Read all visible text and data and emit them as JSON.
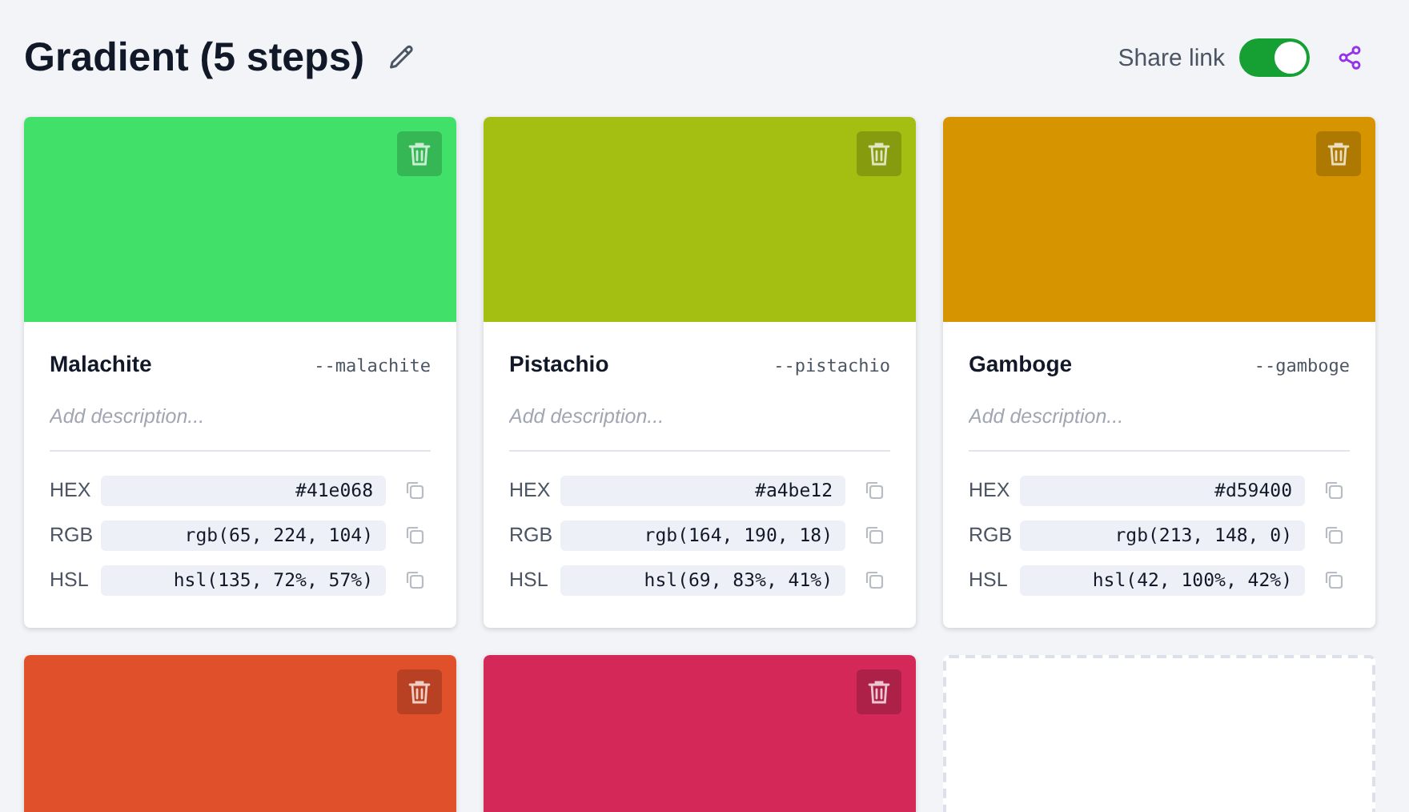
{
  "title": "Gradient (5 steps)",
  "share_link": {
    "label": "Share link",
    "on": true
  },
  "cards": [
    {
      "kind": "swatch",
      "color": "#41e068",
      "name": "Malachite",
      "variable": "--malachite",
      "description_placeholder": "Add description...",
      "values": [
        {
          "label": "HEX",
          "value": "#41e068"
        },
        {
          "label": "RGB",
          "value": "rgb(65, 224, 104)"
        },
        {
          "label": "HSL",
          "value": "hsl(135, 72%, 57%)"
        }
      ]
    },
    {
      "kind": "swatch",
      "color": "#a4be12",
      "name": "Pistachio",
      "variable": "--pistachio",
      "description_placeholder": "Add description...",
      "values": [
        {
          "label": "HEX",
          "value": "#a4be12"
        },
        {
          "label": "RGB",
          "value": "rgb(164, 190, 18)"
        },
        {
          "label": "HSL",
          "value": "hsl(69, 83%, 41%)"
        }
      ]
    },
    {
      "kind": "swatch",
      "color": "#d59400",
      "name": "Gamboge",
      "variable": "--gamboge",
      "description_placeholder": "Add description...",
      "values": [
        {
          "label": "HEX",
          "value": "#d59400"
        },
        {
          "label": "RGB",
          "value": "rgb(213, 148, 0)"
        },
        {
          "label": "HSL",
          "value": "hsl(42, 100%, 42%)"
        }
      ]
    },
    {
      "kind": "swatch",
      "color": "#e0502a"
    },
    {
      "kind": "swatch",
      "color": "#d42858"
    },
    {
      "kind": "empty"
    }
  ]
}
